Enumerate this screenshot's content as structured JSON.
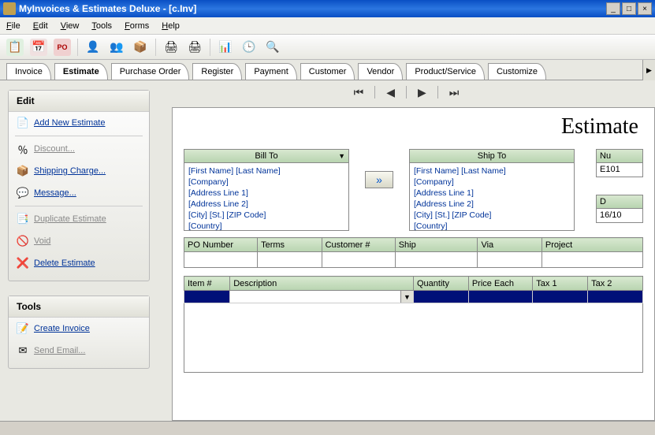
{
  "title": "MyInvoices & Estimates Deluxe - [c.Inv]",
  "menu": [
    "File",
    "Edit",
    "View",
    "Tools",
    "Forms",
    "Help"
  ],
  "tabs": [
    "Invoice",
    "Estimate",
    "Purchase Order",
    "Register",
    "Payment",
    "Customer",
    "Vendor",
    "Product/Service",
    "Customize"
  ],
  "activeTab": "Estimate",
  "editPanel": {
    "title": "Edit",
    "items": [
      {
        "icon": "add-icon",
        "label": "Add New Estimate",
        "emoji": "📄",
        "muted": false
      },
      {
        "icon": "discount-icon",
        "label": "Discount...",
        "emoji": "％",
        "muted": true
      },
      {
        "icon": "shipping-icon",
        "label": "Shipping Charge...",
        "emoji": "📦",
        "muted": false
      },
      {
        "icon": "message-icon",
        "label": "Message...",
        "emoji": "💬",
        "muted": false
      },
      {
        "icon": "duplicate-icon",
        "label": "Duplicate Estimate",
        "emoji": "📑",
        "muted": true
      },
      {
        "icon": "void-icon",
        "label": "Void",
        "emoji": "🚫",
        "muted": true
      },
      {
        "icon": "delete-icon",
        "label": "Delete Estimate",
        "emoji": "❌",
        "muted": false
      }
    ]
  },
  "toolsPanel": {
    "title": "Tools",
    "items": [
      {
        "icon": "create-invoice-icon",
        "label": "Create Invoice",
        "emoji": "📝",
        "muted": false
      },
      {
        "icon": "send-email-icon",
        "label": "Send Email...",
        "emoji": "✉",
        "muted": true
      }
    ]
  },
  "docTitle": "Estimate",
  "billTo": {
    "header": "Bill To",
    "lines": [
      "[First Name]      [Last Name]",
      "[Company]",
      "[Address Line 1]",
      "[Address Line 2]",
      "[City]            [St.]  [ZIP Code]",
      "[Country]"
    ]
  },
  "shipTo": {
    "header": "Ship To",
    "lines": [
      "[First Name]      [Last Name]",
      "[Company]",
      "[Address Line 1]",
      "[Address Line 2]",
      "[City]            [St.]  [ZIP Code]",
      "[Country]"
    ]
  },
  "numberBox": {
    "header": "Nu",
    "value": "E101"
  },
  "dateBox": {
    "header": "D",
    "value": "16/10"
  },
  "gridCols": [
    "PO Number",
    "Terms",
    "Customer #",
    "Ship",
    "Via",
    "Project"
  ],
  "itemsCols": [
    "Item #",
    "Description",
    "Quantity",
    "Price Each",
    "Tax 1",
    "Tax 2"
  ]
}
